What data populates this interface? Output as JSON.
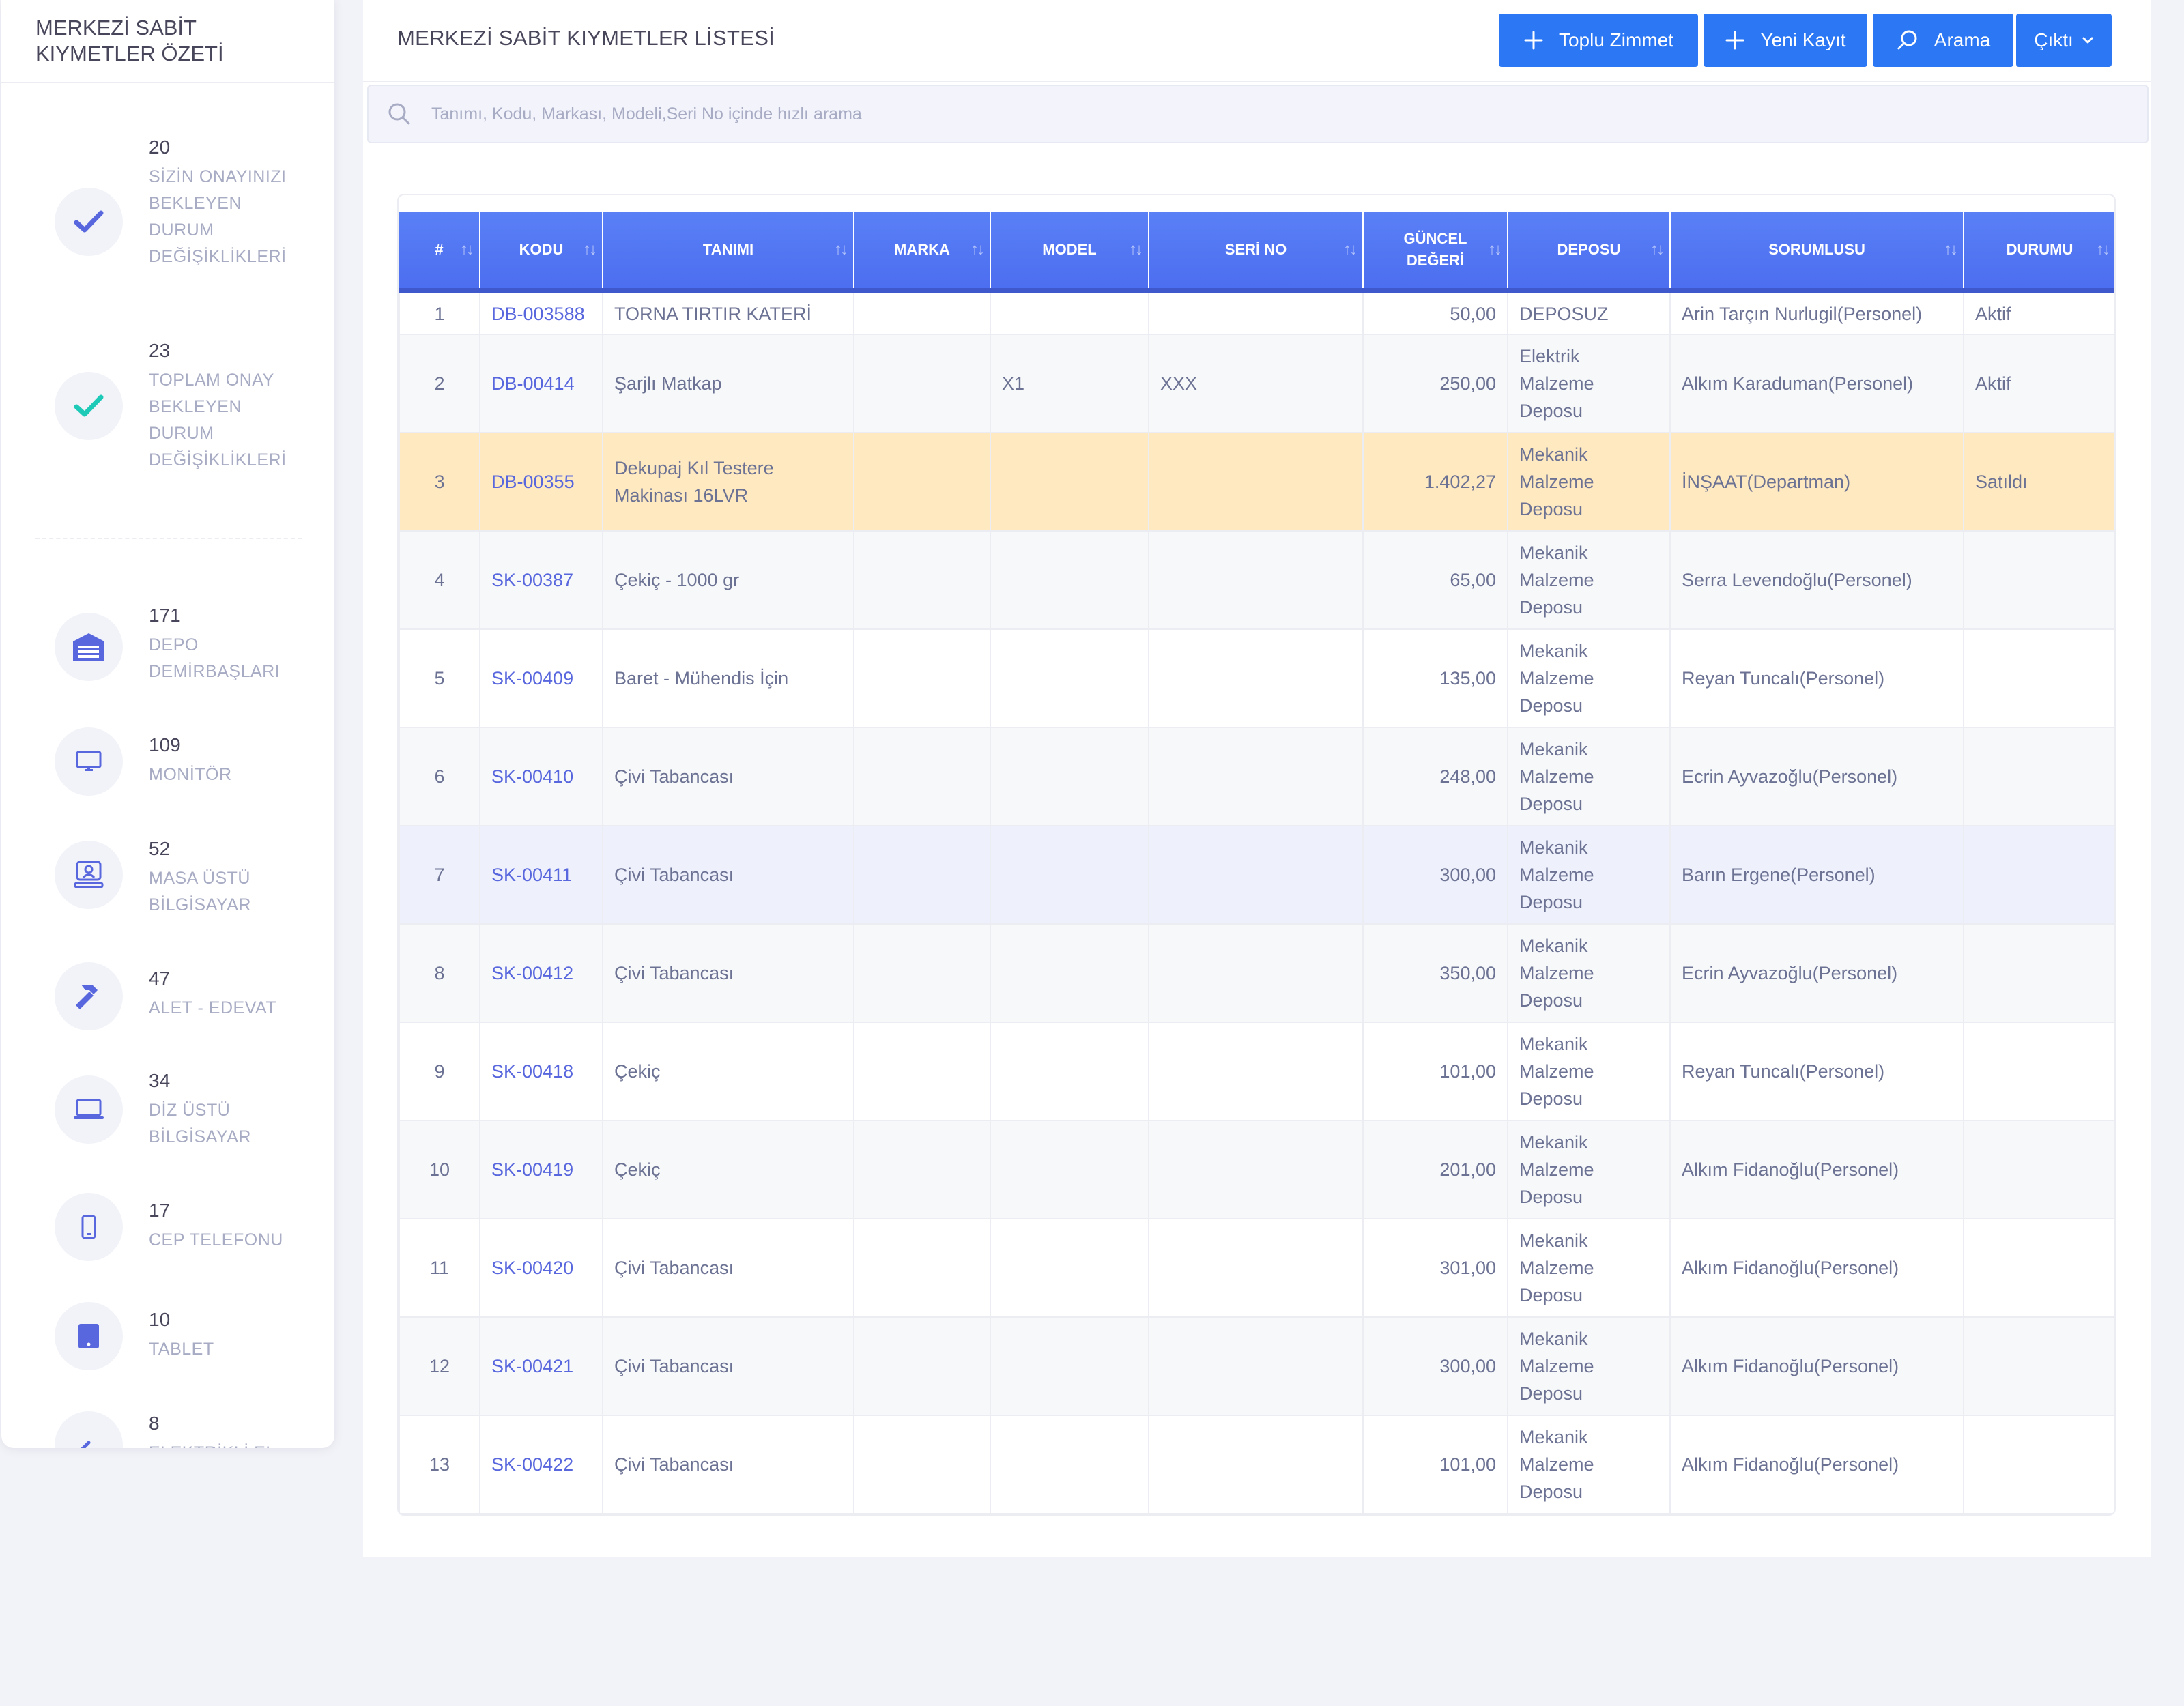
{
  "sidebar": {
    "title": "MERKEZİ SABİT KIYMETLER ÖZETİ",
    "stats": [
      {
        "count": "20",
        "label": "SİZİN ONAYINIZI BEKLEYEN DURUM DEĞİŞİKLİKLERİ",
        "icon": "check-icon",
        "color": "#5867dd"
      },
      {
        "count": "23",
        "label": "TOPLAM ONAY BEKLEYEN DURUM DEĞİŞİKLİKLERİ",
        "icon": "check-icon",
        "color": "#1dc9b7"
      },
      {
        "count": "171",
        "label": "DEPO DEMİRBAŞLARI",
        "icon": "warehouse-icon",
        "color": "#5867dd"
      },
      {
        "count": "109",
        "label": "MONİTÖR",
        "icon": "monitor-icon",
        "color": "#5867dd"
      },
      {
        "count": "52",
        "label": "MASA ÜSTÜ BİLGİSAYAR",
        "icon": "desktop-computer-icon",
        "color": "#5867dd"
      },
      {
        "count": "47",
        "label": "ALET - EDEVAT",
        "icon": "hammer-icon",
        "color": "#5867dd"
      },
      {
        "count": "34",
        "label": "DİZ ÜSTÜ BİLGİSAYAR",
        "icon": "laptop-icon",
        "color": "#5867dd"
      },
      {
        "count": "17",
        "label": "CEP TELEFONU",
        "icon": "mobile-phone-icon",
        "color": "#5867dd"
      },
      {
        "count": "10",
        "label": "TABLET",
        "icon": "tablet-icon",
        "color": "#5867dd"
      },
      {
        "count": "8",
        "label": "ELEKTRİKLİ EL",
        "icon": "tool-icon",
        "color": "#5867dd"
      }
    ]
  },
  "header": {
    "title": "MERKEZİ SABİT KIYMETLER LİSTESİ",
    "buttons": {
      "bulk_assign": "Toplu Zimmet",
      "new_record": "Yeni Kayıt",
      "search": "Arama",
      "output": "Çıktı"
    }
  },
  "search": {
    "placeholder": "Tanımı, Kodu, Markası, Modeli,Seri No içinde hızlı arama"
  },
  "colors": {
    "accent": "#2c77f4",
    "primary": "#5867dd",
    "header_blue": "#5278f4",
    "warning_row": "#ffe9c0",
    "success": "#1dc9b7"
  },
  "table": {
    "columns": [
      "#",
      "KODU",
      "TANIMI",
      "MARKA",
      "MODEL",
      "SERİ NO",
      "GÜNCEL DEĞERİ",
      "DEPOSU",
      "SORUMLUSU",
      "DURUMU"
    ],
    "rows": [
      {
        "no": "1",
        "code": "DB-003588",
        "name": "TORNA TIRTIR KATERİ",
        "brand": "",
        "model": "",
        "serial": "",
        "value": "50,00",
        "depot": "DEPOSUZ",
        "owner": "Arin Tarçın Nurlugil(Personel)",
        "status": "Aktif"
      },
      {
        "no": "2",
        "code": "DB-00414",
        "name": "Şarjlı Matkap",
        "brand": "",
        "model": "X1",
        "serial": "XXX",
        "value": "250,00",
        "depot": "Elektrik Malzeme Deposu",
        "owner": "Alkım Karaduman(Personel)",
        "status": "Aktif"
      },
      {
        "no": "3",
        "code": "DB-00355",
        "name": "Dekupaj Kıl Testere Makinası 16LVR",
        "brand": "",
        "model": "",
        "serial": "",
        "value": "1.402,27",
        "depot": "Mekanik Malzeme Deposu",
        "owner": "İNŞAAT(Departman)",
        "status": "Satıldı"
      },
      {
        "no": "4",
        "code": "SK-00387",
        "name": "Çekiç - 1000 gr",
        "brand": "",
        "model": "",
        "serial": "",
        "value": "65,00",
        "depot": "Mekanik Malzeme Deposu",
        "owner": "Serra Levendoğlu(Personel)",
        "status": ""
      },
      {
        "no": "5",
        "code": "SK-00409",
        "name": "Baret - Mühendis İçin",
        "brand": "",
        "model": "",
        "serial": "",
        "value": "135,00",
        "depot": "Mekanik Malzeme Deposu",
        "owner": "Reyan Tuncalı(Personel)",
        "status": ""
      },
      {
        "no": "6",
        "code": "SK-00410",
        "name": "Çivi Tabancası",
        "brand": "",
        "model": "",
        "serial": "",
        "value": "248,00",
        "depot": "Mekanik Malzeme Deposu",
        "owner": "Ecrin Ayvazoğlu(Personel)",
        "status": ""
      },
      {
        "no": "7",
        "code": "SK-00411",
        "name": "Çivi Tabancası",
        "brand": "",
        "model": "",
        "serial": "",
        "value": "300,00",
        "depot": "Mekanik Malzeme Deposu",
        "owner": "Barın Ergene(Personel)",
        "status": ""
      },
      {
        "no": "8",
        "code": "SK-00412",
        "name": "Çivi Tabancası",
        "brand": "",
        "model": "",
        "serial": "",
        "value": "350,00",
        "depot": "Mekanik Malzeme Deposu",
        "owner": "Ecrin Ayvazoğlu(Personel)",
        "status": ""
      },
      {
        "no": "9",
        "code": "SK-00418",
        "name": "Çekiç",
        "brand": "",
        "model": "",
        "serial": "",
        "value": "101,00",
        "depot": "Mekanik Malzeme Deposu",
        "owner": "Reyan Tuncalı(Personel)",
        "status": ""
      },
      {
        "no": "10",
        "code": "SK-00419",
        "name": "Çekiç",
        "brand": "",
        "model": "",
        "serial": "",
        "value": "201,00",
        "depot": "Mekanik Malzeme Deposu",
        "owner": "Alkım Fidanoğlu(Personel)",
        "status": ""
      },
      {
        "no": "11",
        "code": "SK-00420",
        "name": "Çivi Tabancası",
        "brand": "",
        "model": "",
        "serial": "",
        "value": "301,00",
        "depot": "Mekanik Malzeme Deposu",
        "owner": "Alkım Fidanoğlu(Personel)",
        "status": ""
      },
      {
        "no": "12",
        "code": "SK-00421",
        "name": "Çivi Tabancası",
        "brand": "",
        "model": "",
        "serial": "",
        "value": "300,00",
        "depot": "Mekanik Malzeme Deposu",
        "owner": "Alkım Fidanoğlu(Personel)",
        "status": ""
      },
      {
        "no": "13",
        "code": "SK-00422",
        "name": "Çivi Tabancası",
        "brand": "",
        "model": "",
        "serial": "",
        "value": "101,00",
        "depot": "Mekanik Malzeme Deposu",
        "owner": "Alkım Fidanoğlu(Personel)",
        "status": ""
      }
    ]
  }
}
